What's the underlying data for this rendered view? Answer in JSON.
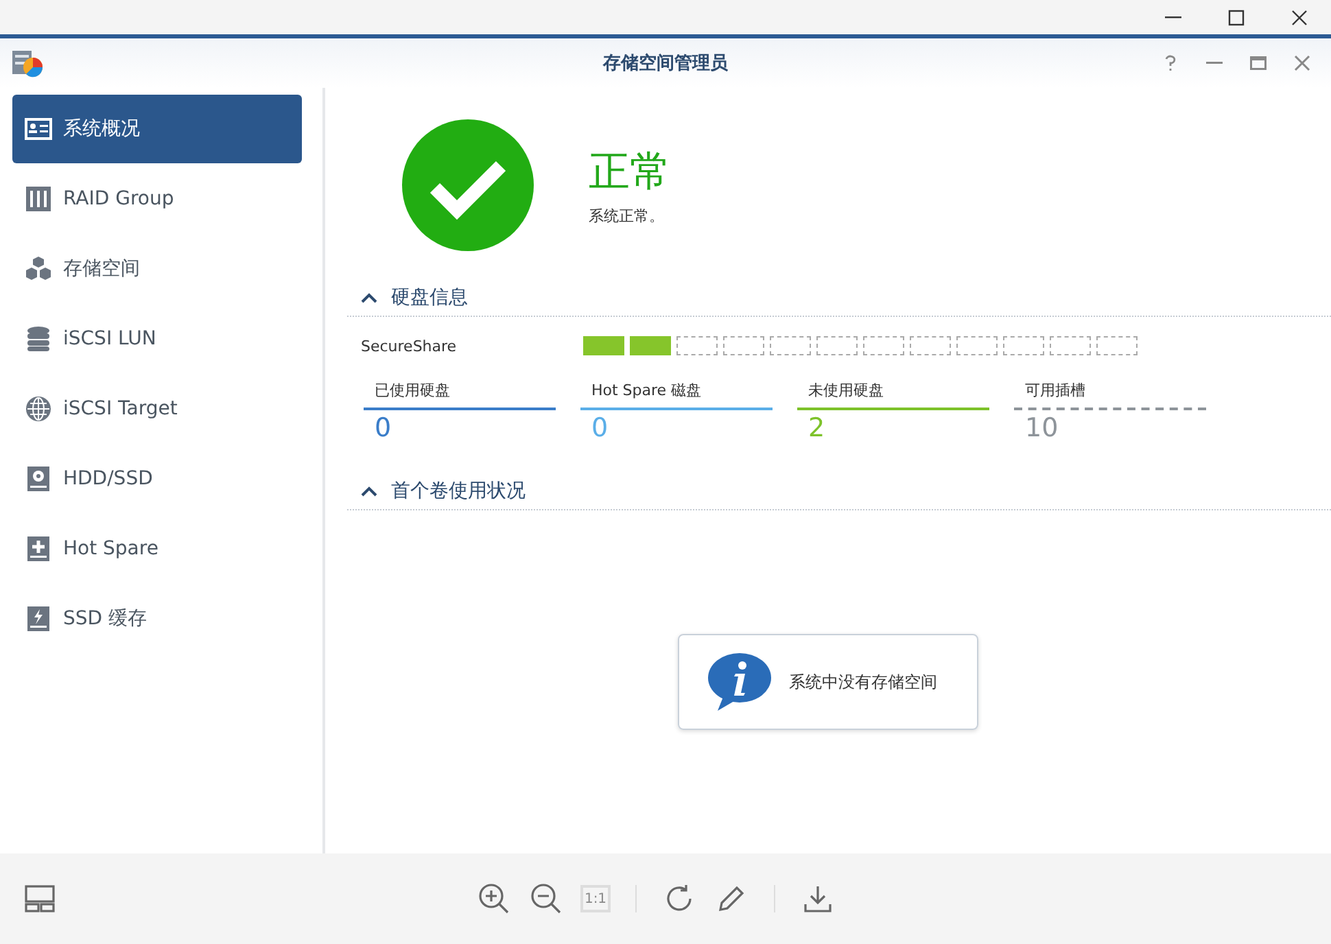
{
  "app_window": {
    "title": "存储空间管理员"
  },
  "sidebar": {
    "items": [
      {
        "label": "系统概况",
        "selected": true
      },
      {
        "label": "RAID Group",
        "selected": false
      },
      {
        "label": "存储空间",
        "selected": false
      },
      {
        "label": "iSCSI LUN",
        "selected": false
      },
      {
        "label": "iSCSI Target",
        "selected": false
      },
      {
        "label": "HDD/SSD",
        "selected": false
      },
      {
        "label": "Hot Spare",
        "selected": false
      },
      {
        "label": "SSD 缓存",
        "selected": false
      }
    ]
  },
  "status": {
    "kind": "ok",
    "title": "正常",
    "message": "系统正常。"
  },
  "disk_info": {
    "title": "硬盘信息",
    "expanded": true,
    "device": "SecureShare",
    "slots": [
      {
        "filled": true
      },
      {
        "filled": true
      },
      {
        "filled": false
      },
      {
        "filled": false
      },
      {
        "filled": false
      },
      {
        "filled": false
      },
      {
        "filled": false
      },
      {
        "filled": false
      },
      {
        "filled": false
      },
      {
        "filled": false
      },
      {
        "filled": false
      },
      {
        "filled": false
      }
    ],
    "stats": [
      {
        "label": "已使用硬盘",
        "value": "0",
        "color": "#3a7dc9",
        "kind": "solid"
      },
      {
        "label": "Hot Spare 磁盘",
        "value": "0",
        "color": "#5aaee8",
        "kind": "solid"
      },
      {
        "label": "未使用硬盘",
        "value": "2",
        "color": "#7dc22a",
        "kind": "solid"
      },
      {
        "label": "可用插槽",
        "value": "10",
        "color": "#8e949a",
        "kind": "dashed"
      }
    ]
  },
  "volume_usage": {
    "title": "首个卷使用状况",
    "expanded": true,
    "notice": "系统中没有存储空间"
  },
  "viewer_toolbar": {
    "actual_size": {
      "label": "1:1",
      "disabled": true
    }
  }
}
